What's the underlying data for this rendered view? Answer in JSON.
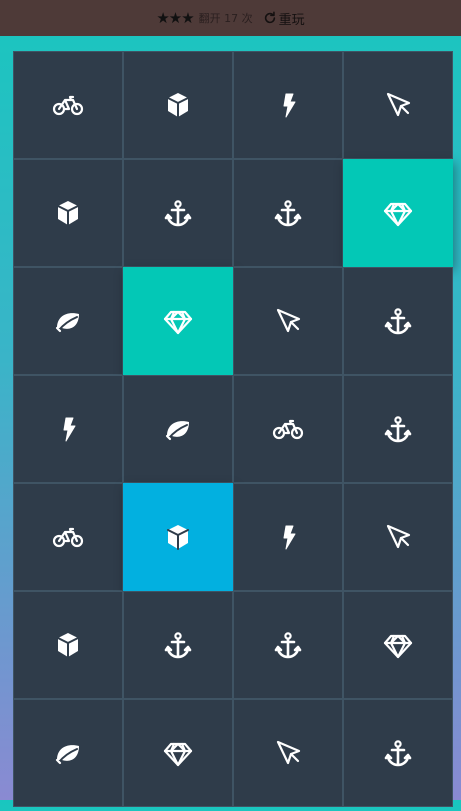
{
  "header": {
    "stars": "★★★",
    "moves_text": "翻开 17 次",
    "restart_label": "重玩"
  },
  "colors": {
    "card_back": "#2f3c4a",
    "matched": "#03c8b6",
    "open": "#02b0e0"
  },
  "board": {
    "columns": 4,
    "cards": [
      {
        "icon": "bicycle-icon",
        "state": "closed"
      },
      {
        "icon": "cube-icon",
        "state": "closed"
      },
      {
        "icon": "bolt-icon",
        "state": "closed"
      },
      {
        "icon": "cursor-icon",
        "state": "closed"
      },
      {
        "icon": "cube-icon",
        "state": "closed"
      },
      {
        "icon": "anchor-icon",
        "state": "closed"
      },
      {
        "icon": "anchor-icon",
        "state": "closed"
      },
      {
        "icon": "diamond-icon",
        "state": "match"
      },
      {
        "icon": "leaf-icon",
        "state": "closed"
      },
      {
        "icon": "diamond-icon",
        "state": "match"
      },
      {
        "icon": "cursor-icon",
        "state": "closed"
      },
      {
        "icon": "anchor-icon",
        "state": "closed"
      },
      {
        "icon": "bolt-icon",
        "state": "closed"
      },
      {
        "icon": "leaf-icon",
        "state": "closed"
      },
      {
        "icon": "bicycle-icon",
        "state": "closed"
      },
      {
        "icon": "anchor-icon",
        "state": "closed"
      },
      {
        "icon": "bicycle-icon",
        "state": "closed"
      },
      {
        "icon": "cube-icon",
        "state": "open"
      },
      {
        "icon": "bolt-icon",
        "state": "closed"
      },
      {
        "icon": "cursor-icon",
        "state": "closed"
      },
      {
        "icon": "cube-icon",
        "state": "closed"
      },
      {
        "icon": "anchor-icon",
        "state": "closed"
      },
      {
        "icon": "anchor-icon",
        "state": "closed"
      },
      {
        "icon": "diamond-icon",
        "state": "closed"
      },
      {
        "icon": "leaf-icon",
        "state": "closed"
      },
      {
        "icon": "diamond-icon",
        "state": "closed"
      },
      {
        "icon": "cursor-icon",
        "state": "closed"
      },
      {
        "icon": "anchor-icon",
        "state": "closed"
      }
    ]
  }
}
